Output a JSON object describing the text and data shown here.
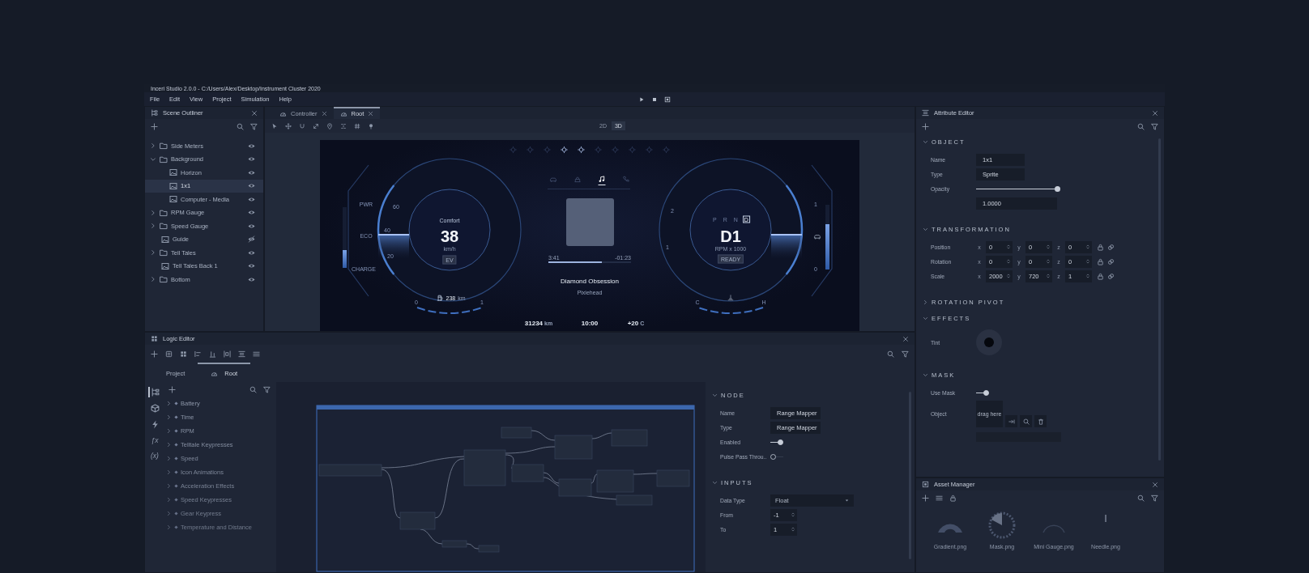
{
  "window": {
    "title": "Inceri Studio 2.0.0 - C:/Users/Alex/Desktop/Instrument Cluster 2020"
  },
  "menu": [
    "File",
    "Edit",
    "View",
    "Project",
    "Simulation",
    "Help"
  ],
  "scene_outliner": {
    "title": "Scene Outliner",
    "items": [
      {
        "label": "Side Meters",
        "kind": "folder",
        "expanded": false,
        "visible": true,
        "selected": false
      },
      {
        "label": "Background",
        "kind": "folder",
        "expanded": true,
        "visible": true,
        "selected": false,
        "children": [
          {
            "label": "Horizon",
            "kind": "image",
            "visible": true,
            "selected": false
          },
          {
            "label": "1x1",
            "kind": "image",
            "visible": true,
            "selected": true
          },
          {
            "label": "Computer - Media",
            "kind": "image",
            "visible": true,
            "selected": false
          }
        ]
      },
      {
        "label": "RPM Gauge",
        "kind": "folder",
        "expanded": false,
        "visible": true,
        "selected": false
      },
      {
        "label": "Speed Gauge",
        "kind": "folder",
        "expanded": false,
        "visible": true,
        "selected": false
      },
      {
        "label": "Guide",
        "kind": "image",
        "visible": false,
        "selected": false
      },
      {
        "label": "Tell Tales",
        "kind": "folder",
        "expanded": false,
        "visible": true,
        "selected": false
      },
      {
        "label": "Tell Tales Back 1",
        "kind": "image",
        "visible": true,
        "selected": false
      },
      {
        "label": "Bottom",
        "kind": "folder",
        "expanded": false,
        "visible": true,
        "selected": false
      }
    ]
  },
  "viewport": {
    "tabs": [
      {
        "label": "Controller",
        "selected": false
      },
      {
        "label": "Root",
        "selected": true
      }
    ],
    "view_modes": [
      {
        "label": "2D",
        "selected": false
      },
      {
        "label": "3D",
        "selected": true
      }
    ],
    "cluster": {
      "telltales": [
        {
          "on": false
        },
        {
          "on": false
        },
        {
          "on": false
        },
        {
          "on": true
        },
        {
          "on": true
        },
        {
          "on": false
        },
        {
          "on": false
        },
        {
          "on": false
        },
        {
          "on": false
        },
        {
          "on": false
        }
      ],
      "left_gauge": {
        "mode": "Comfort",
        "speed": "38",
        "unit": "km/h",
        "badge": "EV",
        "ticks": [
          "60",
          "40",
          "20"
        ],
        "side_meter": {
          "labels": [
            "PWR",
            "ECO",
            "CHARGE"
          ],
          "level": 0.3
        },
        "range": "238",
        "range_unit": "km",
        "scale_min": "0",
        "scale_max": "1"
      },
      "media": {
        "tabs": [
          {
            "kind": "car",
            "selected": false
          },
          {
            "kind": "seat",
            "selected": false
          },
          {
            "kind": "music",
            "selected": true
          },
          {
            "kind": "phone",
            "selected": false
          }
        ],
        "elapsed": "3:41",
        "remaining": "-01:23",
        "level": 0.65,
        "title": "Diamond Obsession",
        "artist": "Pixiehead"
      },
      "right_gauge": {
        "gears": [
          {
            "label": "P",
            "selected": false
          },
          {
            "label": "R",
            "selected": false
          },
          {
            "label": "N",
            "selected": false
          },
          {
            "label": "D",
            "selected": true
          }
        ],
        "gear": "D1",
        "unit": "RPM x 1000",
        "badge": "READY",
        "ticks": [
          "2",
          "1"
        ],
        "side_meter": {
          "labels": [
            "1",
            "0"
          ],
          "level": 0.7
        },
        "scale_min": "C",
        "scale_max": "H"
      },
      "status": {
        "odometer": "31234",
        "odometer_unit": "km",
        "time": "10:00",
        "temperature": "+20",
        "temperature_unit": "C"
      }
    }
  },
  "logic_editor": {
    "title": "Logic Editor",
    "tabs": [
      {
        "label": "Project",
        "selected": false
      },
      {
        "label": "Root",
        "selected": true
      }
    ],
    "categories": [
      {
        "kind": "tree",
        "selected": true
      },
      {
        "kind": "cube",
        "selected": false
      },
      {
        "kind": "bolt",
        "selected": false
      },
      {
        "kind": "text",
        "label": "ƒx",
        "selected": false
      },
      {
        "kind": "text",
        "label": "(x)",
        "selected": false
      }
    ],
    "items": [
      {
        "label": "Battery",
        "expanded": false
      },
      {
        "label": "Time",
        "expanded": false
      },
      {
        "label": "RPM",
        "expanded": false
      },
      {
        "label": "Telltale Keypresses",
        "expanded": false
      },
      {
        "label": "Speed",
        "expanded": false
      },
      {
        "label": "Icon Animations",
        "expanded": false
      },
      {
        "label": "Acceleration Effects",
        "expanded": false
      },
      {
        "label": "Speed Keypresses",
        "expanded": false
      },
      {
        "label": "Gear Keypress",
        "expanded": false
      },
      {
        "label": "Temperature and Distance",
        "expanded": false
      }
    ],
    "inspector": [
      {
        "title": "NODE",
        "expanded": true,
        "rows": [
          {
            "kind": "field",
            "label": "Name",
            "value": "Range Mapper"
          },
          {
            "kind": "field",
            "label": "Type",
            "value": "Range Mapper"
          },
          {
            "kind": "toggle",
            "label": "Enabled",
            "on": true
          },
          {
            "kind": "toggle",
            "label": "Pulse Pass Throu..",
            "on": false
          }
        ]
      },
      {
        "title": "INPUTS",
        "expanded": true,
        "rows": [
          {
            "kind": "dropdown",
            "label": "Data Type",
            "value": "Float"
          },
          {
            "kind": "spin",
            "label": "From",
            "value": "-1"
          },
          {
            "kind": "spin",
            "label": "To",
            "value": "1"
          }
        ]
      }
    ]
  },
  "attribute_editor": {
    "title": "Attribute Editor",
    "sections": [
      {
        "title": "OBJECT",
        "expanded": true,
        "rows": [
          {
            "kind": "field",
            "label": "Name",
            "value": "1x1"
          },
          {
            "kind": "field",
            "label": "Type",
            "value": "Sprite"
          },
          {
            "kind": "slider",
            "label": "Opacity",
            "level": 1,
            "value": "1.0000"
          }
        ]
      },
      {
        "title": "TRANSFORMATION",
        "expanded": true,
        "rows": [
          {
            "kind": "vector",
            "label": "Position",
            "axes": [
              {
                "axis": "x",
                "value": "0"
              },
              {
                "axis": "y",
                "value": "0"
              },
              {
                "axis": "z",
                "value": "0"
              }
            ]
          },
          {
            "kind": "vector",
            "label": "Rotation",
            "axes": [
              {
                "axis": "x",
                "value": "0"
              },
              {
                "axis": "y",
                "value": "0"
              },
              {
                "axis": "z",
                "value": "0"
              }
            ]
          },
          {
            "kind": "vector",
            "label": "Scale",
            "axes": [
              {
                "axis": "x",
                "value": "2000"
              },
              {
                "axis": "y",
                "value": "720"
              },
              {
                "axis": "z",
                "value": "1"
              }
            ]
          }
        ]
      },
      {
        "title": "ROTATION PIVOT",
        "expanded": false
      },
      {
        "title": "EFFECTS",
        "expanded": true,
        "rows": [
          {
            "kind": "color",
            "label": "Tint",
            "color": "#05070d"
          }
        ]
      },
      {
        "title": "MASK",
        "expanded": true,
        "rows": [
          {
            "kind": "toggle",
            "label": "Use Mask",
            "on": true
          },
          {
            "kind": "drop",
            "label": "Object",
            "placeholder": "drag here"
          }
        ]
      }
    ]
  },
  "asset_manager": {
    "title": "Asset Manager",
    "assets": [
      {
        "name": "Gradient.png",
        "kind": "gradient"
      },
      {
        "name": "Mask.png",
        "kind": "mask"
      },
      {
        "name": "Mini Gauge.png",
        "kind": "arc"
      },
      {
        "name": "Needle.png",
        "kind": "needle"
      }
    ]
  }
}
